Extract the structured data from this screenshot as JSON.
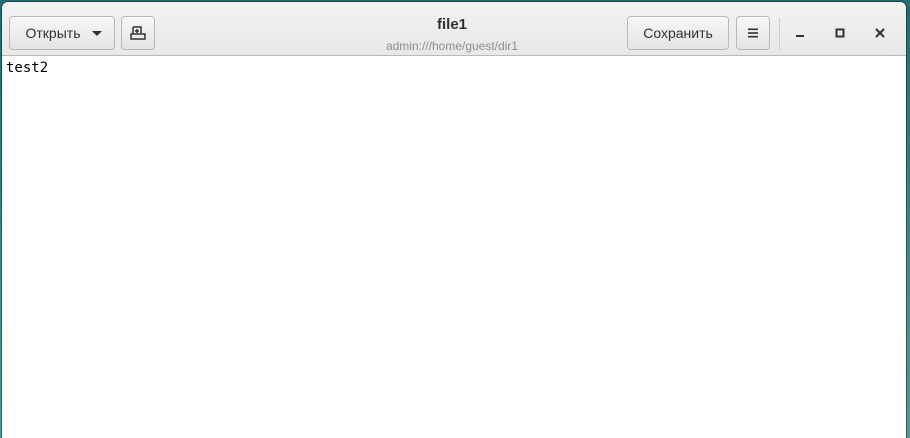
{
  "headerbar": {
    "open_label": "Открыть",
    "save_label": "Сохранить",
    "title": "file1",
    "subtitle": "admin:///home/guest/dir1"
  },
  "icons": {
    "open_menu": "chevron-down-icon",
    "new_tab": "new-document-icon",
    "menu": "hamburger-menu-icon",
    "minimize": "minimize-icon",
    "maximize": "maximize-icon",
    "close": "close-icon"
  },
  "editor": {
    "content": "test2"
  },
  "colors": {
    "desktop_background": "#3a8c8c",
    "headerbar_background": "#ececeb",
    "text": "#2e3436",
    "subtitle": "#8b8e8f"
  }
}
